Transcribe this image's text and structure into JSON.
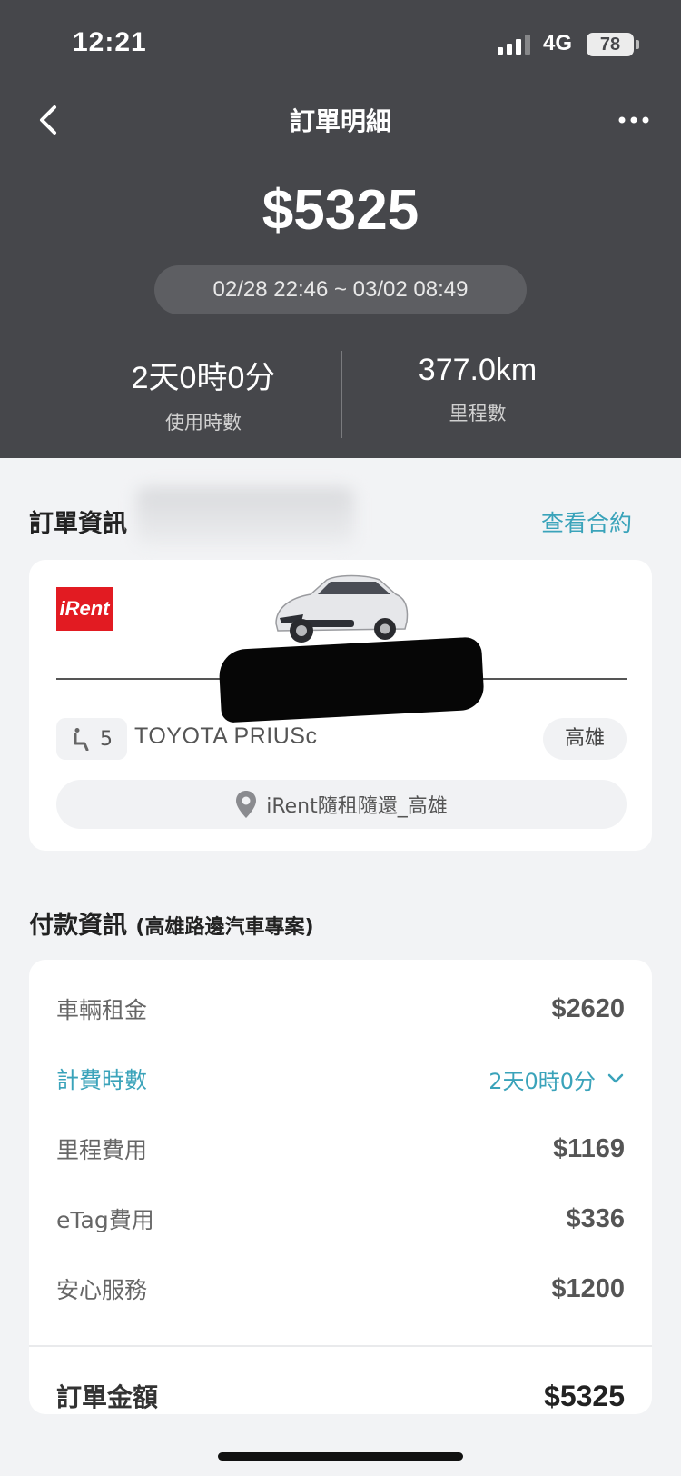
{
  "status": {
    "time": "12:21",
    "network": "4G",
    "battery": "78"
  },
  "header": {
    "title": "訂單明細"
  },
  "summary": {
    "amount": "$5325",
    "range": "02/28 22:46 ~ 03/02 08:49",
    "usage_value": "2天0時0分",
    "usage_label": "使用時數",
    "mileage_value": "377.0km",
    "mileage_label": "里程數"
  },
  "order": {
    "section_title": "訂單資訊",
    "view_contract": "查看合約",
    "brand_logo": "iRent",
    "seats": "5",
    "model": "TOYOTA PRIUSc",
    "region": "高雄",
    "location": "iRent隨租隨還_高雄"
  },
  "payment": {
    "section_title": "付款資訊",
    "section_subtitle": "(高雄路邊汽車專案)",
    "rows": [
      {
        "label": "車輛租金",
        "value": "$2620"
      },
      {
        "label": "計費時數",
        "value": "2天0時0分"
      },
      {
        "label": "里程費用",
        "value": "$1169"
      },
      {
        "label": "eTag費用",
        "value": "$336"
      },
      {
        "label": "安心服務",
        "value": "$1200"
      }
    ],
    "total_label": "訂單金額",
    "total_value": "$5325"
  },
  "icons": {
    "back": "chevron-left-icon",
    "more": "more-dots-icon",
    "seat": "seat-icon",
    "location": "location-pin-icon",
    "expand": "chevron-down-icon"
  },
  "colors": {
    "header_bg": "#46474b",
    "accent": "#3aa3ba",
    "brand_red": "#e21b22"
  }
}
